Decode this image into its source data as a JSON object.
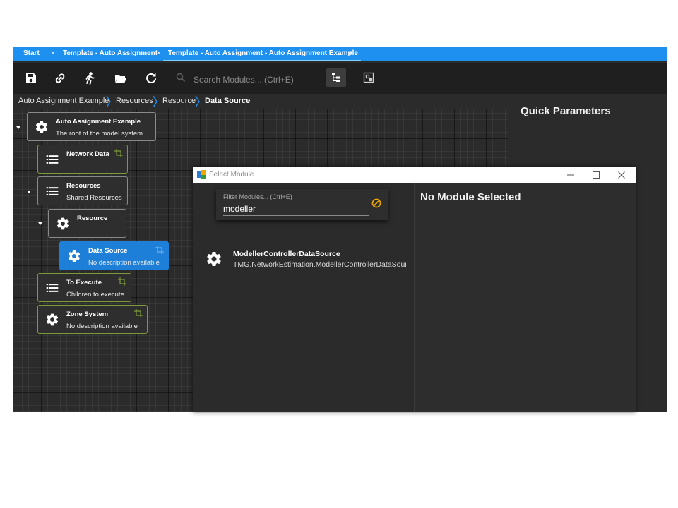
{
  "tabs": [
    {
      "label": "Start",
      "closable": true
    },
    {
      "label": "Template - Auto Assignment",
      "closable": true
    },
    {
      "label": "Template - Auto Assignment - Auto Assignment Example",
      "closable": true,
      "active": true
    }
  ],
  "tab_close_glyph": "×",
  "toolbar": {
    "icons": [
      "save-icon",
      "link-icon",
      "run-icon",
      "folder-open-icon",
      "refresh-icon"
    ],
    "search_placeholder": "Search Modules... (Ctrl+E)",
    "view_buttons": [
      "tree-view-icon",
      "link-view-icon"
    ]
  },
  "breadcrumb": [
    "Auto Assignment Example",
    "Resources",
    "Resource",
    "Data Source"
  ],
  "quick_parameters": {
    "title": "Quick Parameters"
  },
  "tree": {
    "root": {
      "title": "Auto Assignment Example",
      "description": "The root of the model system",
      "icon": "gear-icon"
    },
    "network_data": {
      "title": "Network Data",
      "icon": "list-icon"
    },
    "resources": {
      "title": "Resources",
      "description": "Shared Resources",
      "icon": "list-icon"
    },
    "resource": {
      "title": "Resource",
      "icon": "gear-icon"
    },
    "data_source": {
      "title": "Data Source",
      "description": "No description available",
      "icon": "gear-icon",
      "selected": true
    },
    "to_execute": {
      "title": "To Execute",
      "description": "Children to execute",
      "icon": "list-icon"
    },
    "zone_system": {
      "title": "Zone System",
      "description": "No description available",
      "icon": "gear-icon"
    }
  },
  "dialog": {
    "title": "Select Module",
    "filter_label": "Filter Modules... (Ctrl+E)",
    "filter_value": "modeller",
    "results": [
      {
        "name": "ModellerControllerDataSource",
        "path": "TMG.NetworkEstimation.ModellerControllerDataSource"
      }
    ],
    "no_selection": "No Module Selected"
  },
  "colors": {
    "accent": "#1e90f0",
    "selected_node": "#1e7fd8",
    "green_border": "#7d9a3a",
    "clear_icon": "#f0a800"
  }
}
